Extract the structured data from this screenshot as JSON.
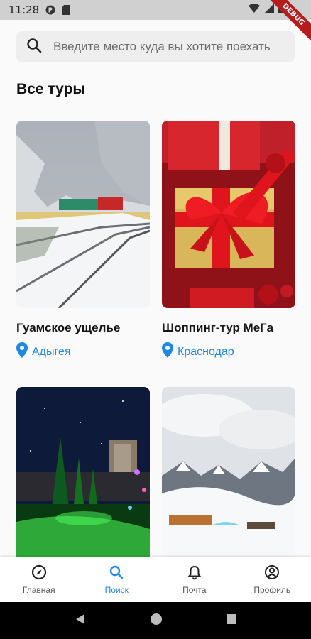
{
  "status_bar": {
    "time": "11:28",
    "debug_label": "DEBUG",
    "icons": [
      "app-icon",
      "sd-card-icon",
      "wifi-icon",
      "signal-icon",
      "battery-icon"
    ]
  },
  "search": {
    "placeholder": "Введите место куда вы хотите поехать"
  },
  "section_title": "Все туры",
  "tours": [
    {
      "title": "Гуамское ущелье",
      "location": "Адыгея",
      "image": "snowy-gorge-train"
    },
    {
      "title": "Шоппинг-тур МеГа",
      "location": "Краснодар",
      "image": "gift-box-red-ribbon"
    },
    {
      "title": "",
      "location": "",
      "image": "night-park-hotel"
    },
    {
      "title": "",
      "location": "",
      "image": "snowy-mountains-resort"
    }
  ],
  "bottom_nav": {
    "items": [
      {
        "label": "Главная",
        "icon": "compass-icon",
        "active": false
      },
      {
        "label": "Поиск",
        "icon": "search-icon",
        "active": true
      },
      {
        "label": "Почта",
        "icon": "bell-icon",
        "active": false
      },
      {
        "label": "Профиль",
        "icon": "profile-icon",
        "active": false
      }
    ]
  },
  "colors": {
    "accent": "#1e88e5",
    "background": "#fafafa",
    "search_bg": "#eeeeee"
  }
}
